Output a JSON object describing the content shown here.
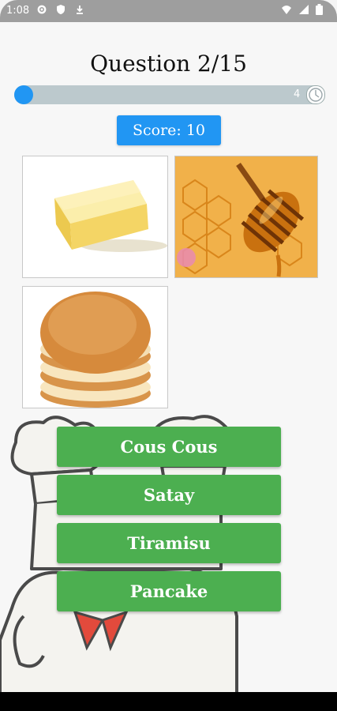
{
  "status_bar": {
    "time": "1:08",
    "icons": [
      "settings-icon",
      "shield-icon",
      "download-icon",
      "wifi-icon",
      "signal-icon",
      "battery-icon"
    ]
  },
  "quiz": {
    "question_label": "Question 2/15",
    "progress_value": 0.02,
    "timer_value": "4",
    "score_label": "Score: 10"
  },
  "images": [
    {
      "name": "butter-image",
      "subject": "butter"
    },
    {
      "name": "honey-image",
      "subject": "honey"
    },
    {
      "name": "pancakes-image",
      "subject": "pancakes"
    }
  ],
  "answers": [
    "Cous Cous",
    "Satay",
    "Tiramisu",
    "Pancake"
  ],
  "colors": {
    "accent_blue": "#2196f3",
    "answer_green": "#4caf50",
    "progress_track": "#bcc9cd"
  }
}
